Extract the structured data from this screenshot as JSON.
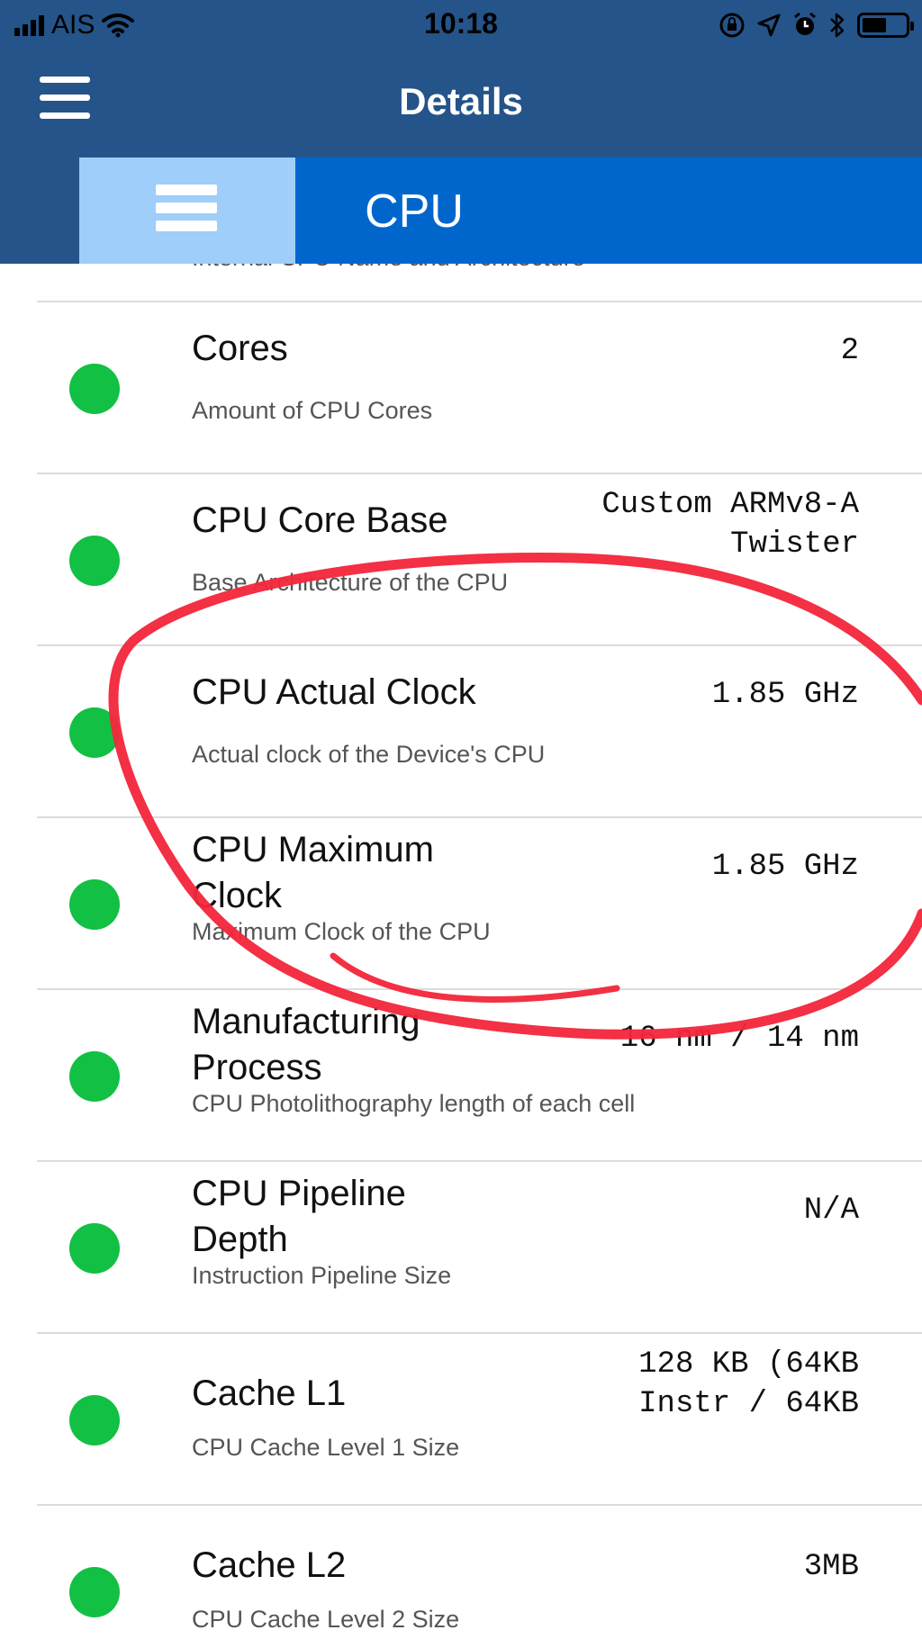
{
  "status_bar": {
    "carrier": "AIS",
    "time": "10:18",
    "icons": [
      "signal-bars-icon",
      "wifi-icon",
      "rotation-lock-icon",
      "location-arrow-icon",
      "alarm-icon",
      "bluetooth-icon",
      "battery-icon"
    ]
  },
  "nav": {
    "title": "Details",
    "menu_icon": "hamburger-menu-icon"
  },
  "tabs": {
    "icon": "list-icon",
    "active_label": "CPU"
  },
  "list": {
    "partial_subtitle": "Internal CPU Name and Architecture",
    "rows": [
      {
        "title": "Cores",
        "subtitle": "Amount of CPU Cores",
        "value": "2"
      },
      {
        "title": "CPU Core Base",
        "subtitle": "Base Architecture of the CPU",
        "value": "Custom ARMv8-A Twister"
      },
      {
        "title": "CPU Actual Clock",
        "subtitle": "Actual clock of the Device's CPU",
        "value": "1.85 GHz"
      },
      {
        "title": "CPU Maximum Clock",
        "subtitle": "Maximum Clock of the CPU",
        "value": "1.85 GHz"
      },
      {
        "title": "Manufacturing Process",
        "subtitle": "CPU Photolithography length of each cell",
        "value": "16 nm / 14 nm"
      },
      {
        "title": "CPU Pipeline Depth",
        "subtitle": "Instruction Pipeline Size",
        "value": "N/A"
      },
      {
        "title": "Cache L1",
        "subtitle": "CPU Cache Level 1 Size",
        "value": "128 KB (64KB Instr / 64KB"
      },
      {
        "title": "Cache L2",
        "subtitle": "CPU Cache Level 2 Size",
        "value": "3MB"
      }
    ]
  },
  "colors": {
    "nav_bar": "#245489",
    "tab_bar": "#0066cc",
    "tab_icon_bg": "#9ecef9",
    "status_dot": "#12c043",
    "annotation": "#f2283c"
  }
}
